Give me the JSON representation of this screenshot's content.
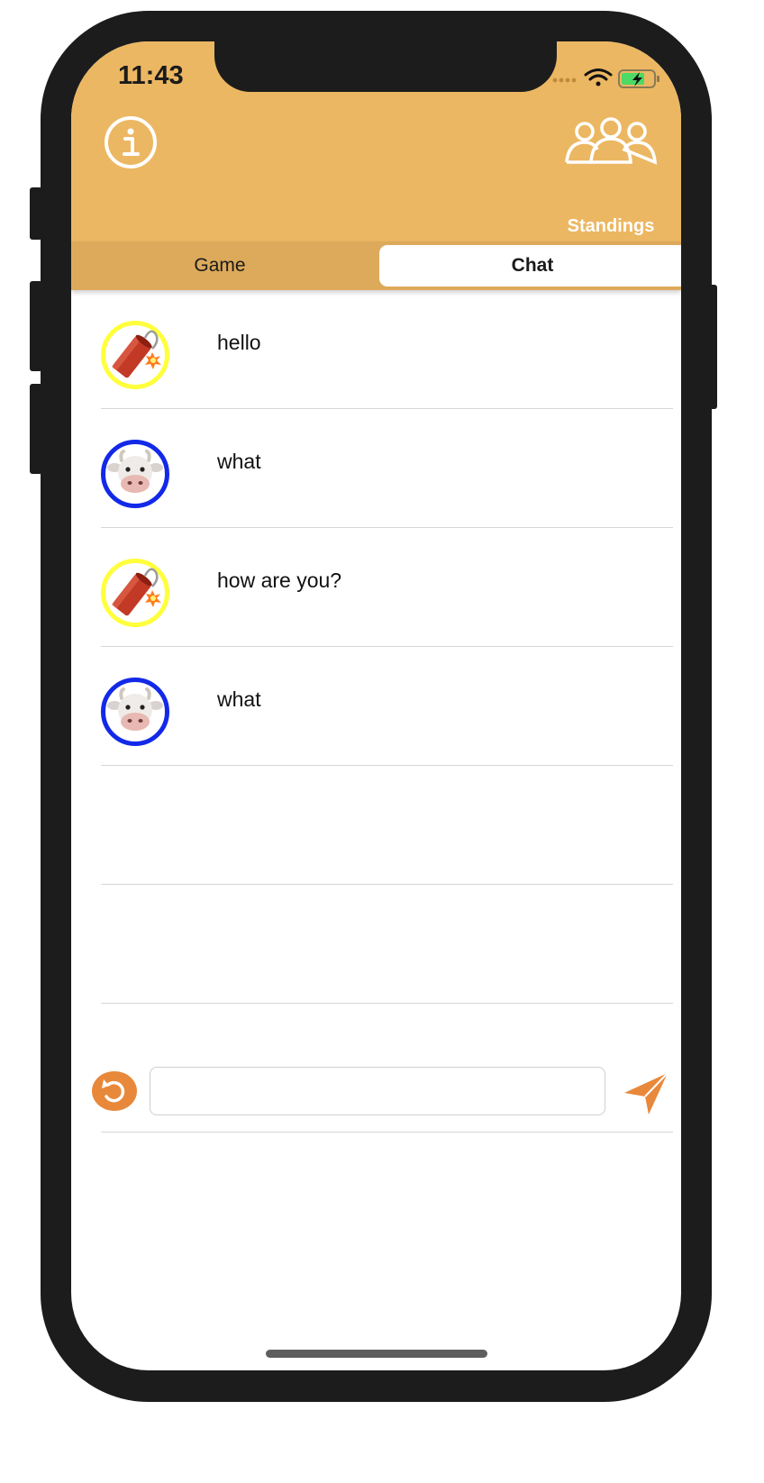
{
  "status_bar": {
    "time": "11:43"
  },
  "header": {
    "info_icon": "info-circle-icon",
    "standings_icon": "group-people-icon",
    "standings_label": "Standings",
    "background_color": "#ecb762"
  },
  "tabs": [
    {
      "label": "Game",
      "selected": false
    },
    {
      "label": "Chat",
      "selected": true
    }
  ],
  "chat": {
    "messages": [
      {
        "avatar": "firecracker",
        "ring_color": "#ffff3b",
        "text": "hello"
      },
      {
        "avatar": "cow-face",
        "ring_color": "#1329e8",
        "text": "what"
      },
      {
        "avatar": "firecracker",
        "ring_color": "#ffff3b",
        "text": "how are you?"
      },
      {
        "avatar": "cow-face",
        "ring_color": "#1329e8",
        "text": "what"
      }
    ],
    "empty_rows": 2
  },
  "composer": {
    "input_value": "",
    "input_placeholder": "",
    "undo_icon": "undo-icon",
    "send_icon": "send-arrow-icon",
    "accent_color": "#e8883a"
  }
}
